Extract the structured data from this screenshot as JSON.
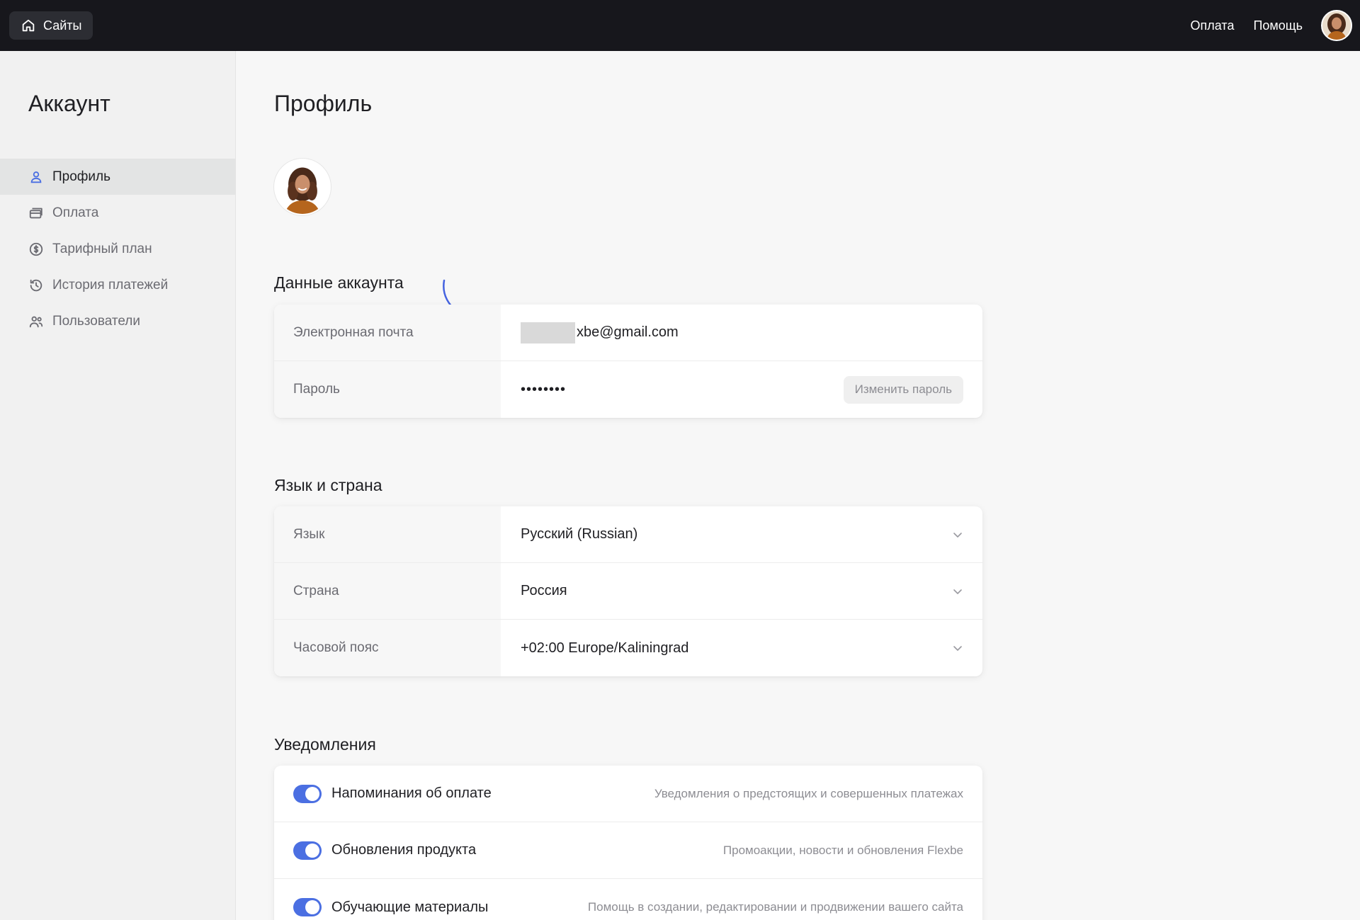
{
  "topbar": {
    "sites_label": "Сайты",
    "links": [
      "Оплата",
      "Помощь"
    ]
  },
  "sidebar": {
    "title": "Аккаунт",
    "items": [
      {
        "label": "Профиль",
        "icon": "user-icon",
        "active": true
      },
      {
        "label": "Оплата",
        "icon": "card-icon",
        "active": false
      },
      {
        "label": "Тарифный план",
        "icon": "dollar-circle-icon",
        "active": false
      },
      {
        "label": "История платежей",
        "icon": "history-icon",
        "active": false
      },
      {
        "label": "Пользователи",
        "icon": "users-icon",
        "active": false
      }
    ]
  },
  "main": {
    "title": "Профиль",
    "account": {
      "title": "Данные аккаунта",
      "email_label": "Электронная почта",
      "email_value": "xbe@gmail.com",
      "password_label": "Пароль",
      "password_value": "••••••••",
      "change_password": "Изменить пароль"
    },
    "locale": {
      "title": "Язык и страна",
      "rows": [
        {
          "label": "Язык",
          "value": "Русский (Russian)"
        },
        {
          "label": "Страна",
          "value": "Россия"
        },
        {
          "label": "Часовой пояс",
          "value": "+02:00 Europe/Kaliningrad"
        }
      ]
    },
    "notifications": {
      "title": "Уведомления",
      "items": [
        {
          "title": "Напоминания об оплате",
          "desc": "Уведомления о предстоящих и совершенных платежах",
          "enabled": true
        },
        {
          "title": "Обновления продукта",
          "desc": "Промоакции, новости и обновления Flexbe",
          "enabled": true
        },
        {
          "title": "Обучающие материалы",
          "desc": "Помощь в создании, редактировании и продвижении вашего сайта",
          "enabled": true
        }
      ]
    }
  },
  "colors": {
    "topbar_bg": "#17171c",
    "accent": "#4b6fe2",
    "sidebar_bg": "#f1f1f1",
    "page_bg": "#f7f7f7"
  }
}
